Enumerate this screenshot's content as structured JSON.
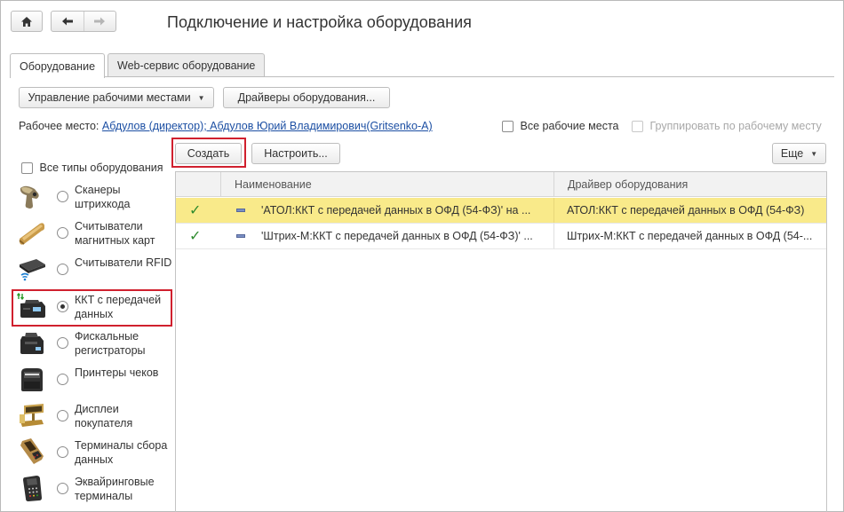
{
  "window": {
    "title": "Подключение и настройка оборудования"
  },
  "tabs": [
    {
      "label": "Оборудование",
      "active": true
    },
    {
      "label": "Web-сервис оборудование",
      "active": false
    }
  ],
  "toolbar": {
    "workplaces_menu_label": "Управление рабочими местами",
    "drivers_button_label": "Драйверы оборудования..."
  },
  "workplace": {
    "label": "Рабочее место:",
    "value": "Абдулов (директор); Абдулов Юрий Владимирович(Gritsenko-A)",
    "all_workplaces_label": "Все рабочие места",
    "group_by_workplace_label": "Группировать по рабочему месту"
  },
  "list_toolbar": {
    "create_label": "Создать",
    "configure_label": "Настроить...",
    "more_label": "Еще"
  },
  "sidebar": {
    "all_types_label": "Все типы оборудования",
    "items": [
      {
        "label": "Сканеры штрихкода",
        "icon": "barcode-scanner-icon",
        "selected": false
      },
      {
        "label": "Считыватели магнитных карт",
        "icon": "magnetic-card-reader-icon",
        "selected": false
      },
      {
        "label": "Считыватели RFID",
        "icon": "rfid-reader-icon",
        "selected": false
      },
      {
        "label": "ККТ с передачей данных",
        "icon": "online-cash-register-icon",
        "selected": true
      },
      {
        "label": "Фискальные регистраторы",
        "icon": "fiscal-printer-icon",
        "selected": false
      },
      {
        "label": "Принтеры чеков",
        "icon": "receipt-printer-icon",
        "selected": false
      },
      {
        "label": "Дисплеи покупателя",
        "icon": "customer-display-icon",
        "selected": false
      },
      {
        "label": "Терминалы сбора данных",
        "icon": "data-terminal-icon",
        "selected": false
      },
      {
        "label": "Эквайринговые терминалы",
        "icon": "acquiring-terminal-icon",
        "selected": false
      }
    ]
  },
  "table": {
    "columns": [
      "Наименование",
      "Драйвер оборудования"
    ],
    "rows": [
      {
        "name": "'АТОЛ:ККТ с передачей данных в ОФД (54-ФЗ)' на ...",
        "driver": "АТОЛ:ККТ с передачей данных в ОФД (54-ФЗ)",
        "selected": true
      },
      {
        "name": "'Штрих-М:ККТ с передачей данных в ОФД (54-ФЗ)' ...",
        "driver": "Штрих-М:ККТ с передачей данных в ОФД (54-...",
        "selected": false
      }
    ]
  },
  "colors": {
    "selected_row": "#f9ea8a",
    "link": "#1c4fa3",
    "highlight_frame": "#d0202e",
    "check": "#2e8b2e"
  }
}
